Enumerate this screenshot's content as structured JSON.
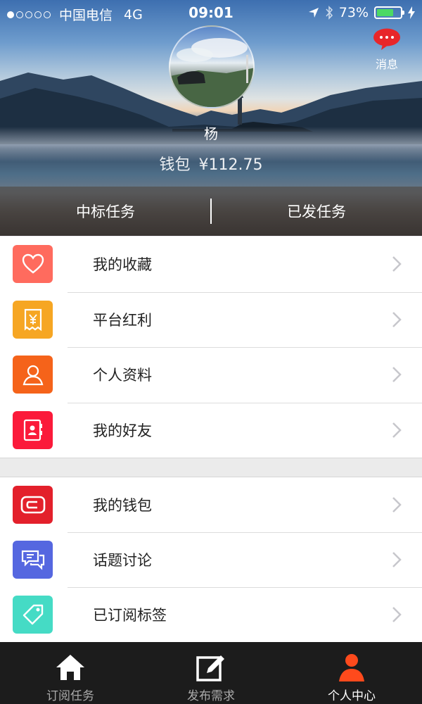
{
  "status_bar": {
    "carrier": "中国电信",
    "network": "4G",
    "time": "09:01",
    "battery": "73%",
    "battery_level": 0.73,
    "signal_dots_filled": 1,
    "signal_dots_total": 5
  },
  "header": {
    "message_label": "消息",
    "user_name": "杨",
    "wallet_label": "钱包",
    "wallet_amount": "¥112.75",
    "tabs": [
      {
        "label": "中标任务"
      },
      {
        "label": "已发任务"
      }
    ]
  },
  "menu": {
    "group1": [
      {
        "label": "我的收藏",
        "icon": "heart-icon",
        "color": "#ff6b5e"
      },
      {
        "label": "平台红利",
        "icon": "receipt-yen-icon",
        "color": "#f6a623"
      },
      {
        "label": "个人资料",
        "icon": "person-icon",
        "color": "#f5631a"
      },
      {
        "label": "我的好友",
        "icon": "contacts-icon",
        "color": "#fb1a3a"
      }
    ],
    "group2": [
      {
        "label": "我的钱包",
        "icon": "wallet-icon",
        "color": "#e3202b"
      },
      {
        "label": "话题讨论",
        "icon": "chat-icon",
        "color": "#5567e0"
      },
      {
        "label": "已订阅标签",
        "icon": "tag-icon",
        "color": "#45dbc5"
      }
    ]
  },
  "tab_bar": {
    "items": [
      {
        "label": "订阅任务",
        "icon": "home-icon"
      },
      {
        "label": "发布需求",
        "icon": "edit-icon"
      },
      {
        "label": "个人中心",
        "icon": "user-icon",
        "active": true
      }
    ],
    "active_color": "#ff4a1c"
  }
}
